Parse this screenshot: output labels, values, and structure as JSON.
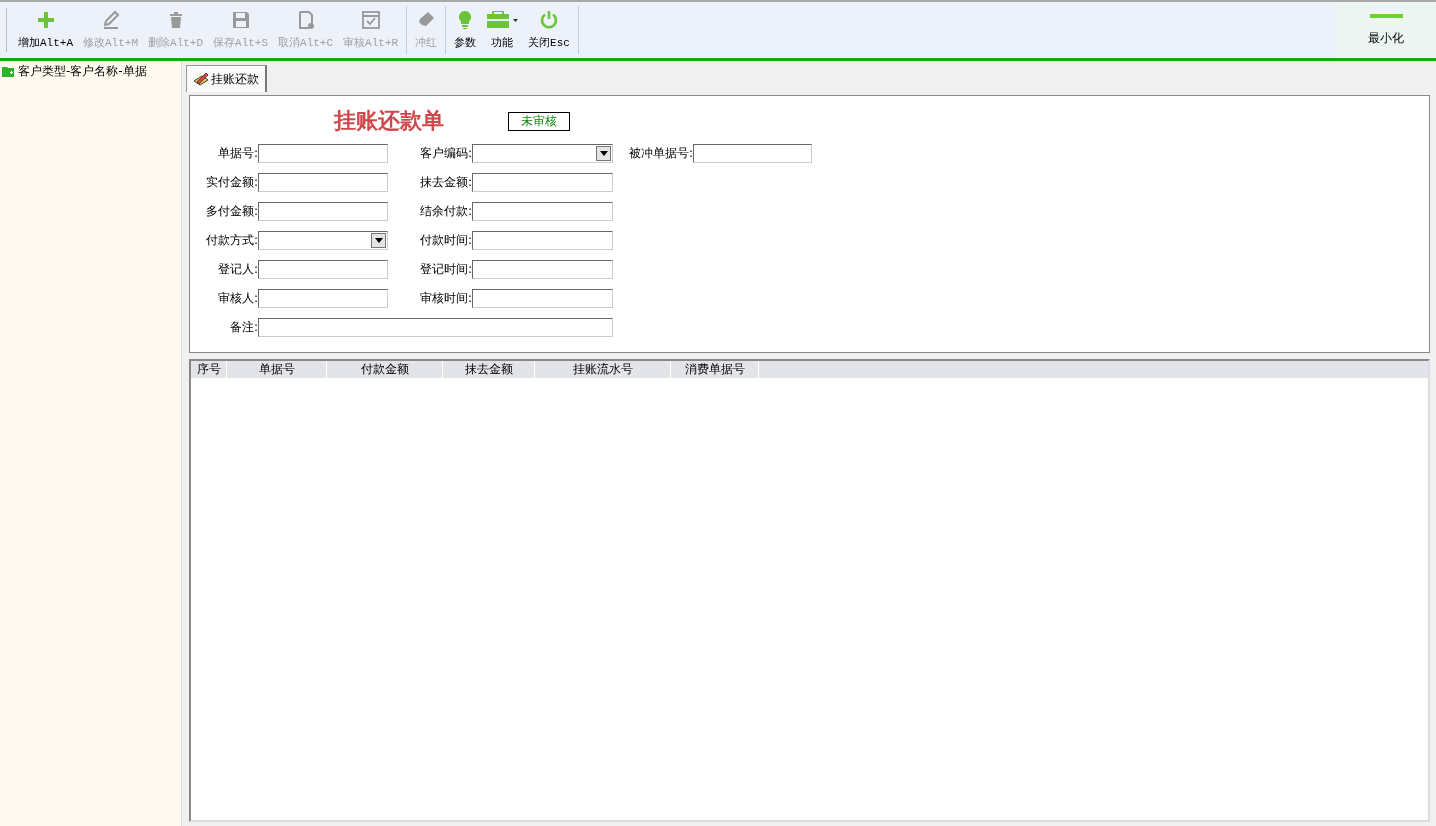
{
  "toolbar": [
    {
      "kind": "add",
      "label": "增加Alt+A",
      "disabled": false
    },
    {
      "kind": "edit",
      "label": "修改Alt+M",
      "disabled": true
    },
    {
      "kind": "delete",
      "label": "删除Alt+D",
      "disabled": true
    },
    {
      "kind": "save",
      "label": "保存Alt+S",
      "disabled": true
    },
    {
      "kind": "cancel",
      "label": "取消Alt+C",
      "disabled": true
    },
    {
      "kind": "approve",
      "label": "审核Alt+R",
      "disabled": true
    },
    {
      "kind": "reverse",
      "label": "冲红",
      "disabled": true
    },
    {
      "kind": "params",
      "label": "参数",
      "disabled": false
    },
    {
      "kind": "functions",
      "label": "功能",
      "disabled": false
    },
    {
      "kind": "close",
      "label": "关闭Esc",
      "disabled": false
    }
  ],
  "minimize": {
    "label": "最小化"
  },
  "sidebar": {
    "items": [
      {
        "label": "客户类型-客户名称-单据"
      }
    ]
  },
  "tabs": [
    {
      "label": "挂账还款",
      "selected": true
    }
  ],
  "form": {
    "title": "挂账还款单",
    "status": "未审核",
    "rows": [
      [
        {
          "label": "单据号:",
          "kind": "text"
        },
        {
          "label": "客户编码:",
          "kind": "dropdown"
        },
        {
          "label": "被冲单据号:",
          "kind": "text"
        }
      ],
      [
        {
          "label": "实付金额:",
          "kind": "text"
        },
        {
          "label": "抹去金额:",
          "kind": "text"
        }
      ],
      [
        {
          "label": "多付金额:",
          "kind": "text"
        },
        {
          "label": "结余付款:",
          "kind": "text"
        }
      ],
      [
        {
          "label": "付款方式:",
          "kind": "dropdown"
        },
        {
          "label": "付款时间:",
          "kind": "text"
        }
      ],
      [
        {
          "label": "登记人:",
          "kind": "text"
        },
        {
          "label": "登记时间:",
          "kind": "text"
        }
      ],
      [
        {
          "label": "审核人:",
          "kind": "text"
        },
        {
          "label": "审核时间:",
          "kind": "text"
        }
      ],
      [
        {
          "label": "备注:",
          "kind": "wide"
        }
      ]
    ]
  },
  "table": {
    "columns": [
      "序号",
      "单据号",
      "付款金额",
      "抹去金额",
      "挂账流水号",
      "消费单据号"
    ]
  }
}
